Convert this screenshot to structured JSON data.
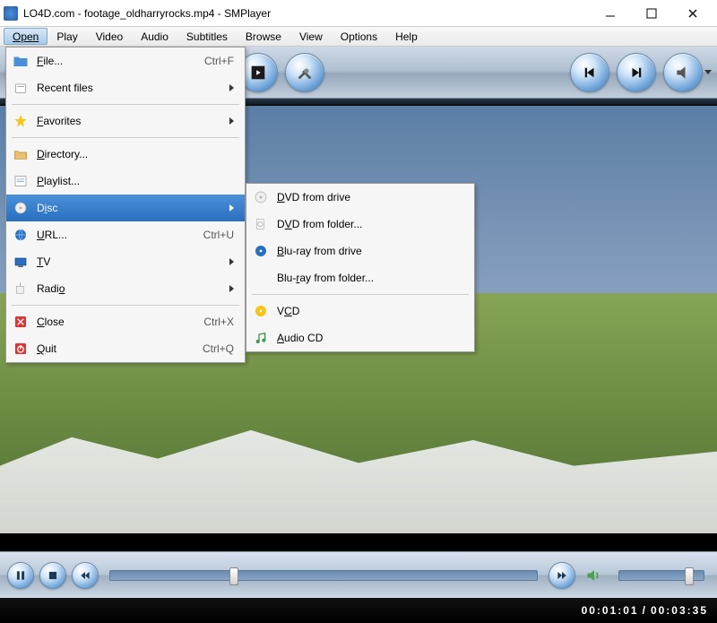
{
  "window": {
    "title": "LO4D.com - footage_oldharryrocks.mp4 - SMPlayer"
  },
  "menubar": {
    "items": [
      {
        "label": "Open",
        "active": true
      },
      {
        "label": "Play"
      },
      {
        "label": "Video"
      },
      {
        "label": "Audio"
      },
      {
        "label": "Subtitles"
      },
      {
        "label": "Browse"
      },
      {
        "label": "View"
      },
      {
        "label": "Options"
      },
      {
        "label": "Help"
      }
    ]
  },
  "open_menu": {
    "file": {
      "label": "File...",
      "shortcut": "Ctrl+F"
    },
    "recent": {
      "label": "Recent files"
    },
    "favorites": {
      "label": "Favorites"
    },
    "directory": {
      "label": "Directory..."
    },
    "playlist": {
      "label": "Playlist..."
    },
    "disc": {
      "label": "Disc"
    },
    "url": {
      "label": "URL...",
      "shortcut": "Ctrl+U"
    },
    "tv": {
      "label": "TV"
    },
    "radio": {
      "label": "Radio"
    },
    "close": {
      "label": "Close",
      "shortcut": "Ctrl+X"
    },
    "quit": {
      "label": "Quit",
      "shortcut": "Ctrl+Q"
    }
  },
  "disc_menu": {
    "dvd_drive": {
      "label": "DVD from drive"
    },
    "dvd_folder": {
      "label": "DVD from folder..."
    },
    "bluray_drive": {
      "label": "Blu-ray from drive"
    },
    "bluray_folder": {
      "label": "Blu-ray from folder..."
    },
    "vcd": {
      "label": "VCD"
    },
    "audio_cd": {
      "label": "Audio CD"
    }
  },
  "status": {
    "current": "00:01:01",
    "sep": "/",
    "total": "00:03:35"
  }
}
